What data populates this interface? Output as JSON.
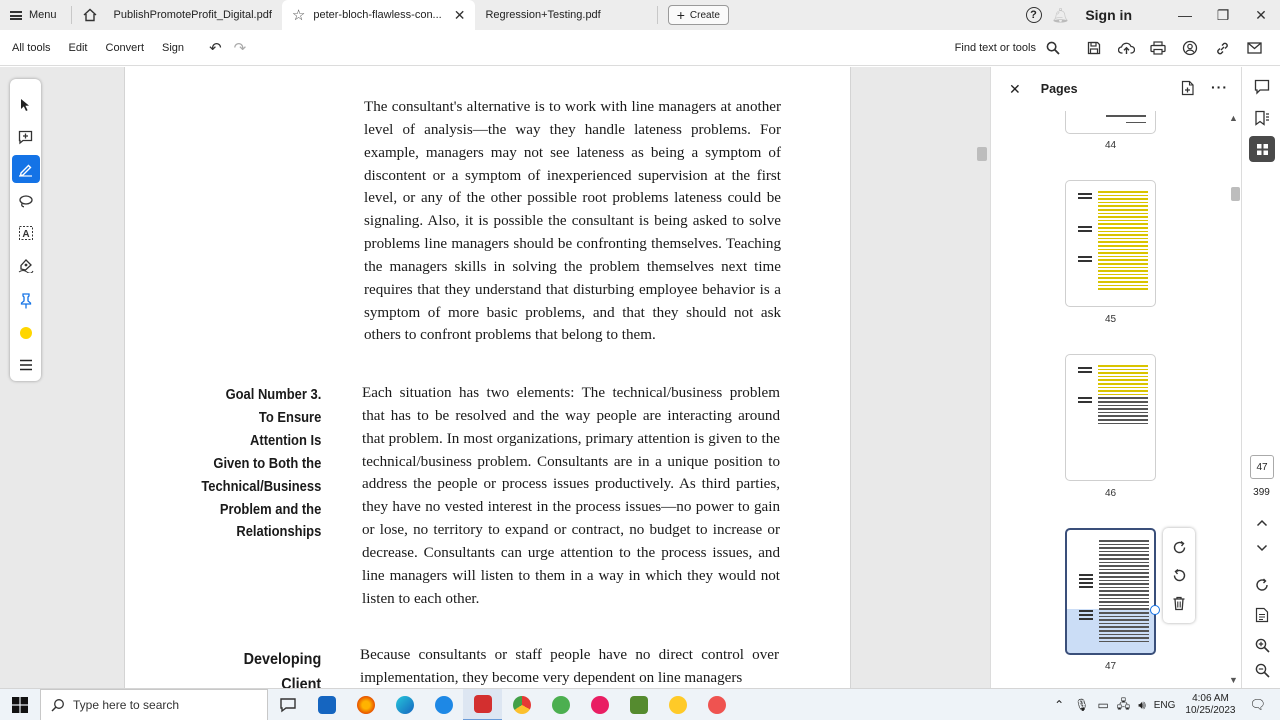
{
  "tabbar": {
    "menu_label": "Menu",
    "tabs": [
      {
        "label": "PublishPromoteProfit_Digital.pdf"
      },
      {
        "label": "peter-bloch-flawless-con..."
      },
      {
        "label": "Regression+Testing.pdf"
      }
    ],
    "create_label": "Create",
    "signin_label": "Sign in"
  },
  "toolbar": {
    "items": [
      "All tools",
      "Edit",
      "Convert",
      "Sign"
    ],
    "find_label": "Find text or tools"
  },
  "document": {
    "para1": "The consultant's alternative is to work with line managers at another level of analysis—the way they handle lateness problems. For example, managers may not see lateness as being a symptom of discontent or a symptom of inexperienced supervision at the first level, or any of the other possible root problems lateness could be signaling. Also, it is possible the consultant is being asked to solve problems line managers should be confronting themselves. Teaching the managers skills in solving the problem themselves next time requires that they understand that disturbing employee behavior is a symptom of more basic problems, and that they should not ask others to confront problems that belong to them.",
    "heading1_lines": [
      "Goal Number 3.",
      "To Ensure",
      "Attention Is",
      "Given to Both the",
      "Technical/Business",
      "Problem and the",
      "Relationships"
    ],
    "para2": "Each situation has two elements: The technical/business problem that has to be resolved and the way people are interacting around that problem. In most organizations, primary attention is given to the technical/business problem. Consultants are in a unique position to address the people or process issues productively. As third parties, they have no vested interest in the process issues—no power to gain or lose, no territory to expand or contract, no budget to increase or decrease. Consultants can urge attention to the process issues, and line managers will listen to them in a way in which they would not listen to each other.",
    "heading2_lines": [
      "Developing",
      "Client"
    ],
    "para3": "Because consultants or staff people have no direct control over implementation, they become very dependent on line managers"
  },
  "pages_panel": {
    "title": "Pages",
    "page_numbers": [
      "44",
      "45",
      "46",
      "47"
    ]
  },
  "right_rail": {
    "current_page": "47",
    "total_pages": "399"
  },
  "taskbar": {
    "search_placeholder": "Type here to search",
    "language": "ENG",
    "time": "4:06 AM",
    "date": "10/25/2023"
  }
}
